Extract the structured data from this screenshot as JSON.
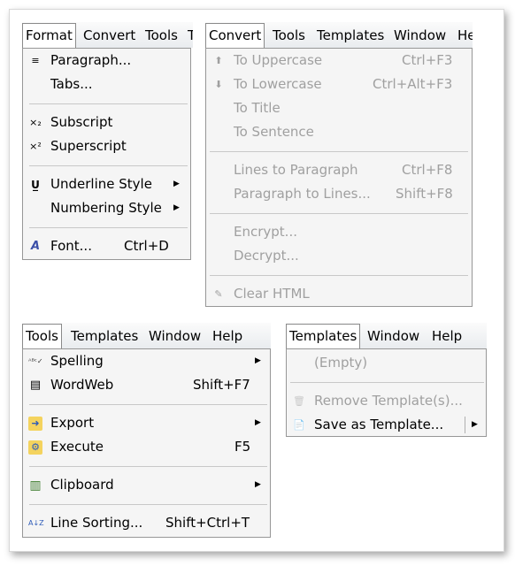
{
  "format_menu": {
    "bar": [
      "Format",
      "Convert",
      "Tools",
      "T"
    ],
    "items": [
      {
        "icon": "≡",
        "label": "Paragraph..."
      },
      {
        "label": "Tabs..."
      },
      {
        "icon": "×₂",
        "label": "Subscript"
      },
      {
        "icon": "×²",
        "label": "Superscript"
      },
      {
        "icon": "U̲",
        "label": "Underline Style",
        "arrow": "▶"
      },
      {
        "label": "Numbering Style",
        "arrow": "▶"
      },
      {
        "icon": "A",
        "label": "Font...",
        "shortcut": "Ctrl+D"
      }
    ]
  },
  "convert_menu": {
    "bar": [
      "Convert",
      "Tools",
      "Templates",
      "Window",
      "He"
    ],
    "items": [
      {
        "icon": "⬆",
        "label": "To Uppercase",
        "shortcut": "Ctrl+F3"
      },
      {
        "icon": "⬇",
        "label": "To Lowercase",
        "shortcut": "Ctrl+Alt+F3"
      },
      {
        "label": "To Title"
      },
      {
        "label": "To Sentence"
      },
      {
        "label": "Lines to Paragraph",
        "shortcut": "Ctrl+F8"
      },
      {
        "label": "Paragraph to Lines...",
        "shortcut": "Shift+F8"
      },
      {
        "label": "Encrypt..."
      },
      {
        "label": "Decrypt..."
      },
      {
        "icon": "✎",
        "label": "Clear HTML"
      }
    ]
  },
  "tools_menu": {
    "bar": [
      "Tools",
      "Templates",
      "Window",
      "Help"
    ],
    "items": [
      {
        "icon": "ᴬᴮᶜ✓",
        "label": "Spelling",
        "arrow": "▶"
      },
      {
        "icon": "▤",
        "label": "WordWeb",
        "shortcut": "Shift+F7"
      },
      {
        "icon": "➜",
        "label": "Export",
        "arrow": "▶"
      },
      {
        "icon": "⚙",
        "label": "Execute",
        "shortcut": "F5"
      },
      {
        "icon": "▥",
        "label": "Clipboard",
        "arrow": "▶"
      },
      {
        "icon": "A↓Z",
        "label": "Line Sorting...",
        "shortcut": "Shift+Ctrl+T"
      }
    ]
  },
  "templates_menu": {
    "bar": [
      "Templates",
      "Window",
      "Help"
    ],
    "items": [
      {
        "label": "(Empty)"
      },
      {
        "icon": "🗑",
        "label": "Remove Template(s)..."
      },
      {
        "icon": "📄",
        "label": "Save as Template...",
        "arrow": "▶"
      }
    ]
  },
  "colors": {
    "disabled_text": "#a0a0a0",
    "menu_background": "#f5f5f5",
    "separator": "#c8c8c8"
  }
}
